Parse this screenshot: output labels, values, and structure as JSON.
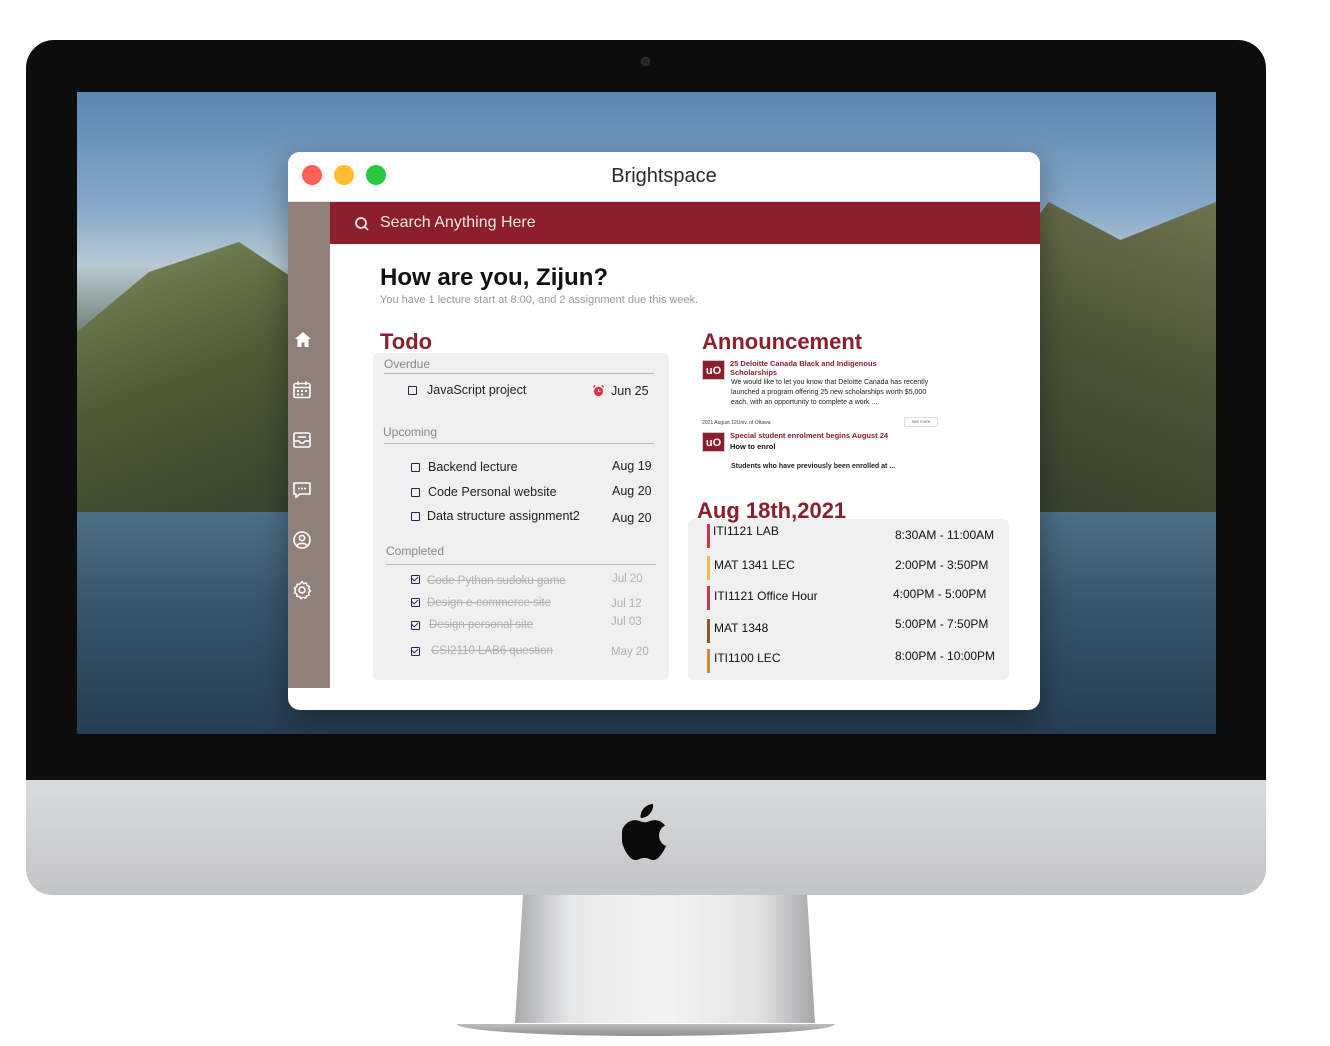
{
  "window": {
    "title": "Brightspace"
  },
  "search": {
    "placeholder": "Search Anything Here"
  },
  "sidebar": {
    "items": [
      {
        "icon": "home-icon"
      },
      {
        "icon": "calendar-icon"
      },
      {
        "icon": "inbox-icon"
      },
      {
        "icon": "chat-icon"
      },
      {
        "icon": "profile-icon"
      },
      {
        "icon": "gear-icon"
      }
    ]
  },
  "greeting": {
    "title": "How are you, Zijun?",
    "subtitle": "You have 1 lecture start at 8:00, and 2 assignment due this week."
  },
  "todo": {
    "title": "Todo",
    "overdue": {
      "label": "Overdue",
      "items": [
        {
          "label": "JavaScript project",
          "date": "Jun 25",
          "icon": "alarm-icon"
        }
      ]
    },
    "upcoming": {
      "label": "Upcoming",
      "items": [
        {
          "label": "Backend lecture",
          "date": "Aug 19"
        },
        {
          "label": "Code Personal website",
          "date": "Aug 20"
        },
        {
          "label": "Data structure assignment2",
          "date": "Aug 20"
        }
      ]
    },
    "completed": {
      "label": "Completed",
      "items": [
        {
          "label": "Code Python sudoku game",
          "date": "Jul 20"
        },
        {
          "label": "Design e-commerce site",
          "date": "Jul 12"
        },
        {
          "label": "Design personal site",
          "date": "Jul 03"
        },
        {
          "label": "CSI2110 LAB6 question",
          "date": "May 20"
        }
      ]
    }
  },
  "announcement": {
    "title": "Announcement",
    "items": [
      {
        "badge": "uO",
        "title": "25 Deloitte Canada Black and Indigenous Scholarships",
        "body": "We would like to let you know that Deloitte Canada has recently launched a program offering 25 new scholarships worth $5,000 each, with an opportunity to complete a work ...",
        "meta": "2021 August 12Univ. of Ottawa",
        "action": "see more"
      },
      {
        "badge": "uO",
        "title": "Special student enrolment begins August 24",
        "subtitle": "How to enrol",
        "body": "Students who have previously been enrolled at ..."
      }
    ]
  },
  "schedule": {
    "date": "Aug 18th,2021",
    "items": [
      {
        "name": "ITI1121 LAB",
        "time": "8:30AM - 11:00AM",
        "color": "#d0344a"
      },
      {
        "name": "MAT 1341 LEC",
        "time": "2:00PM - 3:50PM",
        "color": "#f5b84f"
      },
      {
        "name": "ITI1121 Office Hour",
        "time": "4:00PM - 5:00PM",
        "color": "#d0344a"
      },
      {
        "name": "MAT 1348",
        "time": "5:00PM - 7:50PM",
        "color": "#8a5a2c"
      },
      {
        "name": "ITI1100 LEC",
        "time": "8:00PM - 10:00PM",
        "color": "#c98b3c"
      }
    ]
  },
  "colors": {
    "accent": "#8b1f2b",
    "sidebar": "#8f8079",
    "panel": "#f0f0f0"
  }
}
